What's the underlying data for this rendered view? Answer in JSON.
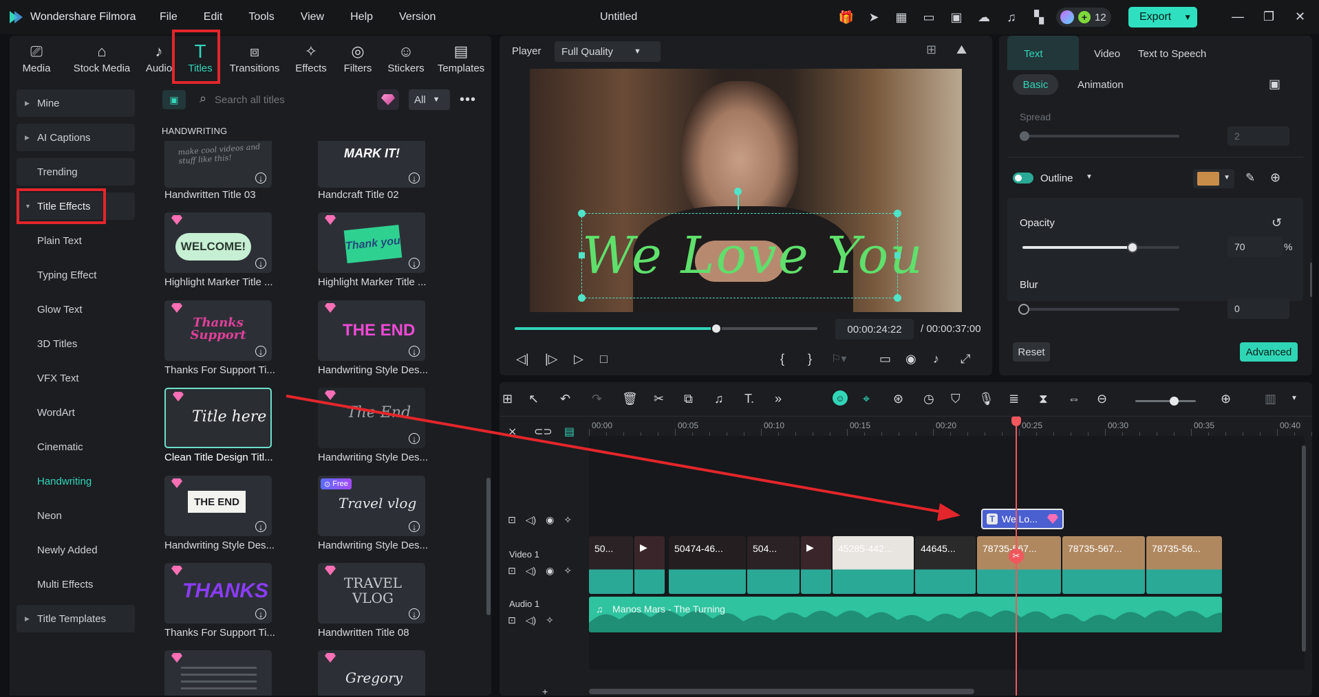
{
  "app": {
    "name": "Wondershare Filmora",
    "doc_title": "Untitled",
    "credits": "12",
    "export": "Export"
  },
  "menu": [
    "File",
    "Edit",
    "Tools",
    "View",
    "Help",
    "Version"
  ],
  "tabs": [
    {
      "label": "Media",
      "icon": "media-icon"
    },
    {
      "label": "Stock Media",
      "icon": "stock-media-icon"
    },
    {
      "label": "Audio",
      "icon": "audio-icon"
    },
    {
      "label": "Titles",
      "icon": "titles-icon"
    },
    {
      "label": "Transitions",
      "icon": "transitions-icon"
    },
    {
      "label": "Effects",
      "icon": "effects-icon"
    },
    {
      "label": "Filters",
      "icon": "filters-icon"
    },
    {
      "label": "Stickers",
      "icon": "stickers-icon"
    },
    {
      "label": "Templates",
      "icon": "templates-icon"
    }
  ],
  "categories": [
    {
      "label": "Mine"
    },
    {
      "label": "AI Captions"
    },
    {
      "label": "Trending"
    },
    {
      "label": "Title Effects"
    },
    {
      "label": "Plain Text"
    },
    {
      "label": "Typing Effect"
    },
    {
      "label": "Glow Text"
    },
    {
      "label": "3D Titles"
    },
    {
      "label": "VFX Text"
    },
    {
      "label": "WordArt"
    },
    {
      "label": "Cinematic"
    },
    {
      "label": "Handwriting"
    },
    {
      "label": "Neon"
    },
    {
      "label": "Newly Added"
    },
    {
      "label": "Multi Effects"
    },
    {
      "label": "Title Templates"
    }
  ],
  "search": {
    "placeholder": "Search all titles",
    "filter": "All"
  },
  "section_heading": "HANDWRITING",
  "titles": [
    {
      "label": "Handwritten Title 03",
      "thumb_text": "make cool videos and stuff like this!"
    },
    {
      "label": "Handcraft Title 02",
      "thumb_text": "MARK IT!"
    },
    {
      "label": "Highlight Marker Title ...",
      "thumb_text": "WELCOME!"
    },
    {
      "label": "Highlight Marker Title ...",
      "thumb_text": "Thank you"
    },
    {
      "label": "Thanks For Support Ti...",
      "thumb_text": "Thanks Support"
    },
    {
      "label": "Handwriting Style Des...",
      "thumb_text": "THE END"
    },
    {
      "label": "Clean Title Design Titl...",
      "thumb_text": "Title here"
    },
    {
      "label": "Handwriting Style Des...",
      "thumb_text": "The End"
    },
    {
      "label": "Handwriting Style Des...",
      "thumb_text": "THE END"
    },
    {
      "label": "Handwriting Style Des...",
      "thumb_text": "Travel vlog"
    },
    {
      "label": "Thanks For Support Ti...",
      "thumb_text": "THANKS"
    },
    {
      "label": "Handwritten Title 08",
      "thumb_text": "TRAVEL VLOG"
    },
    {
      "label": "",
      "thumb_text": ""
    },
    {
      "label": "",
      "thumb_text": "Gregory"
    }
  ],
  "free_badge": "Free",
  "player": {
    "label": "Player",
    "quality": "Full Quality",
    "overlay_text": "We Love You",
    "current": "00:00:24:22",
    "total": "/ 00:00:37:00",
    "progress": 0.665
  },
  "props": {
    "tabs": [
      "Text",
      "Video",
      "Text to Speech"
    ],
    "subtabs": [
      "Basic",
      "Animation"
    ],
    "spread_label": "Spread",
    "spread_value": "2",
    "outline_label": "Outline",
    "outline_color": "#c98d4a",
    "opacity_label": "Opacity",
    "opacity_value": "70",
    "opacity_unit": "%",
    "opacity_level": 0.7,
    "blur_label": "Blur",
    "blur_value": "0",
    "reset": "Reset",
    "advanced": "Advanced"
  },
  "timeline": {
    "ruler": [
      "00:00",
      "00:05",
      "00:10",
      "00:15",
      "00:20",
      "00:25",
      "00:30",
      "00:35",
      "00:40"
    ],
    "title_clip": "We Lo...",
    "video_label": "Video 1",
    "audio_label": "Audio 1",
    "audio_clip": "Manos Mars - The Turning",
    "clips": [
      "50...",
      "",
      "50474-46...",
      "504...",
      "",
      "45285-442...",
      "44645...",
      "78735-567...",
      "78735-567...",
      "78735-56..."
    ]
  },
  "colors": {
    "accent": "#31d6b8",
    "highlight": "#e3262b",
    "playhead": "#f0585d",
    "title_clip": "#4a5fd0"
  }
}
